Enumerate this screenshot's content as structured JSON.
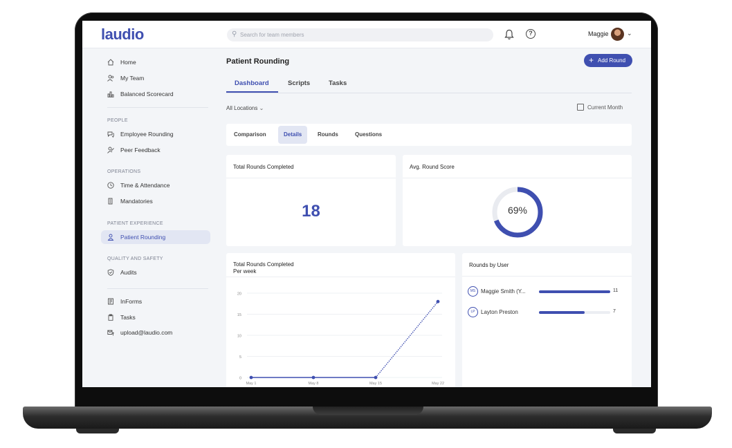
{
  "app": {
    "logo": "laudio"
  },
  "header": {
    "search_placeholder": "Search for team members",
    "user_name": "Maggie"
  },
  "sidebar": {
    "top_items": [
      {
        "label": "Home",
        "icon": "home-icon"
      },
      {
        "label": "My Team",
        "icon": "team-icon"
      },
      {
        "label": "Balanced Scorecard",
        "icon": "scorecard-icon"
      }
    ],
    "sections": [
      {
        "title": "PEOPLE",
        "items": [
          {
            "label": "Employee Rounding",
            "icon": "chat-icon"
          },
          {
            "label": "Peer Feedback",
            "icon": "feedback-icon"
          }
        ]
      },
      {
        "title": "OPERATIONS",
        "items": [
          {
            "label": "Time & Attendance",
            "icon": "clock-icon"
          },
          {
            "label": "Mandatories",
            "icon": "document-icon"
          }
        ]
      },
      {
        "title": "PATIENT EXPERIENCE",
        "items": [
          {
            "label": "Patient Rounding",
            "icon": "person-icon",
            "active": true
          }
        ]
      },
      {
        "title": "QUALITY AND SAFETY",
        "items": [
          {
            "label": "Audits",
            "icon": "shield-icon"
          }
        ]
      }
    ],
    "bottom_items": [
      {
        "label": "InForms",
        "icon": "form-icon"
      },
      {
        "label": "Tasks",
        "icon": "clipboard-icon"
      },
      {
        "label": "upload@laudio.com",
        "icon": "upload-mail-icon"
      }
    ]
  },
  "main": {
    "title": "Patient Rounding",
    "add_button": "Add Round",
    "tabs": [
      "Dashboard",
      "Scripts",
      "Tasks"
    ],
    "active_tab": "Dashboard",
    "location_filter": "All Locations",
    "date_filter": "Current Month",
    "subtabs": [
      "Comparison",
      "Details",
      "Rounds",
      "Questions"
    ],
    "active_subtab": "Details",
    "total_rounds": {
      "title": "Total Rounds Completed",
      "value": "18"
    },
    "avg_score": {
      "title": "Avg. Round Score",
      "value_label": "69%",
      "value": 0.69
    },
    "weekly": {
      "title": "Total Rounds Completed",
      "subtitle": "Per week"
    },
    "rounds_by_user": {
      "title": "Rounds by User",
      "max": 11,
      "users": [
        {
          "initials": "MS",
          "name": "Maggie Smith (Y...",
          "value": 11
        },
        {
          "initials": "LP",
          "name": "Layton Preston",
          "value": 7
        }
      ]
    }
  },
  "chart_data": {
    "type": "line",
    "categories": [
      "May 1",
      "May 8",
      "May 15",
      "May 22"
    ],
    "values": [
      0,
      0,
      0,
      18
    ],
    "ylim": [
      0,
      20
    ],
    "yticks": [
      "0",
      "5",
      "10",
      "15",
      "20"
    ],
    "grid": true,
    "color": "#3f4fb0"
  }
}
